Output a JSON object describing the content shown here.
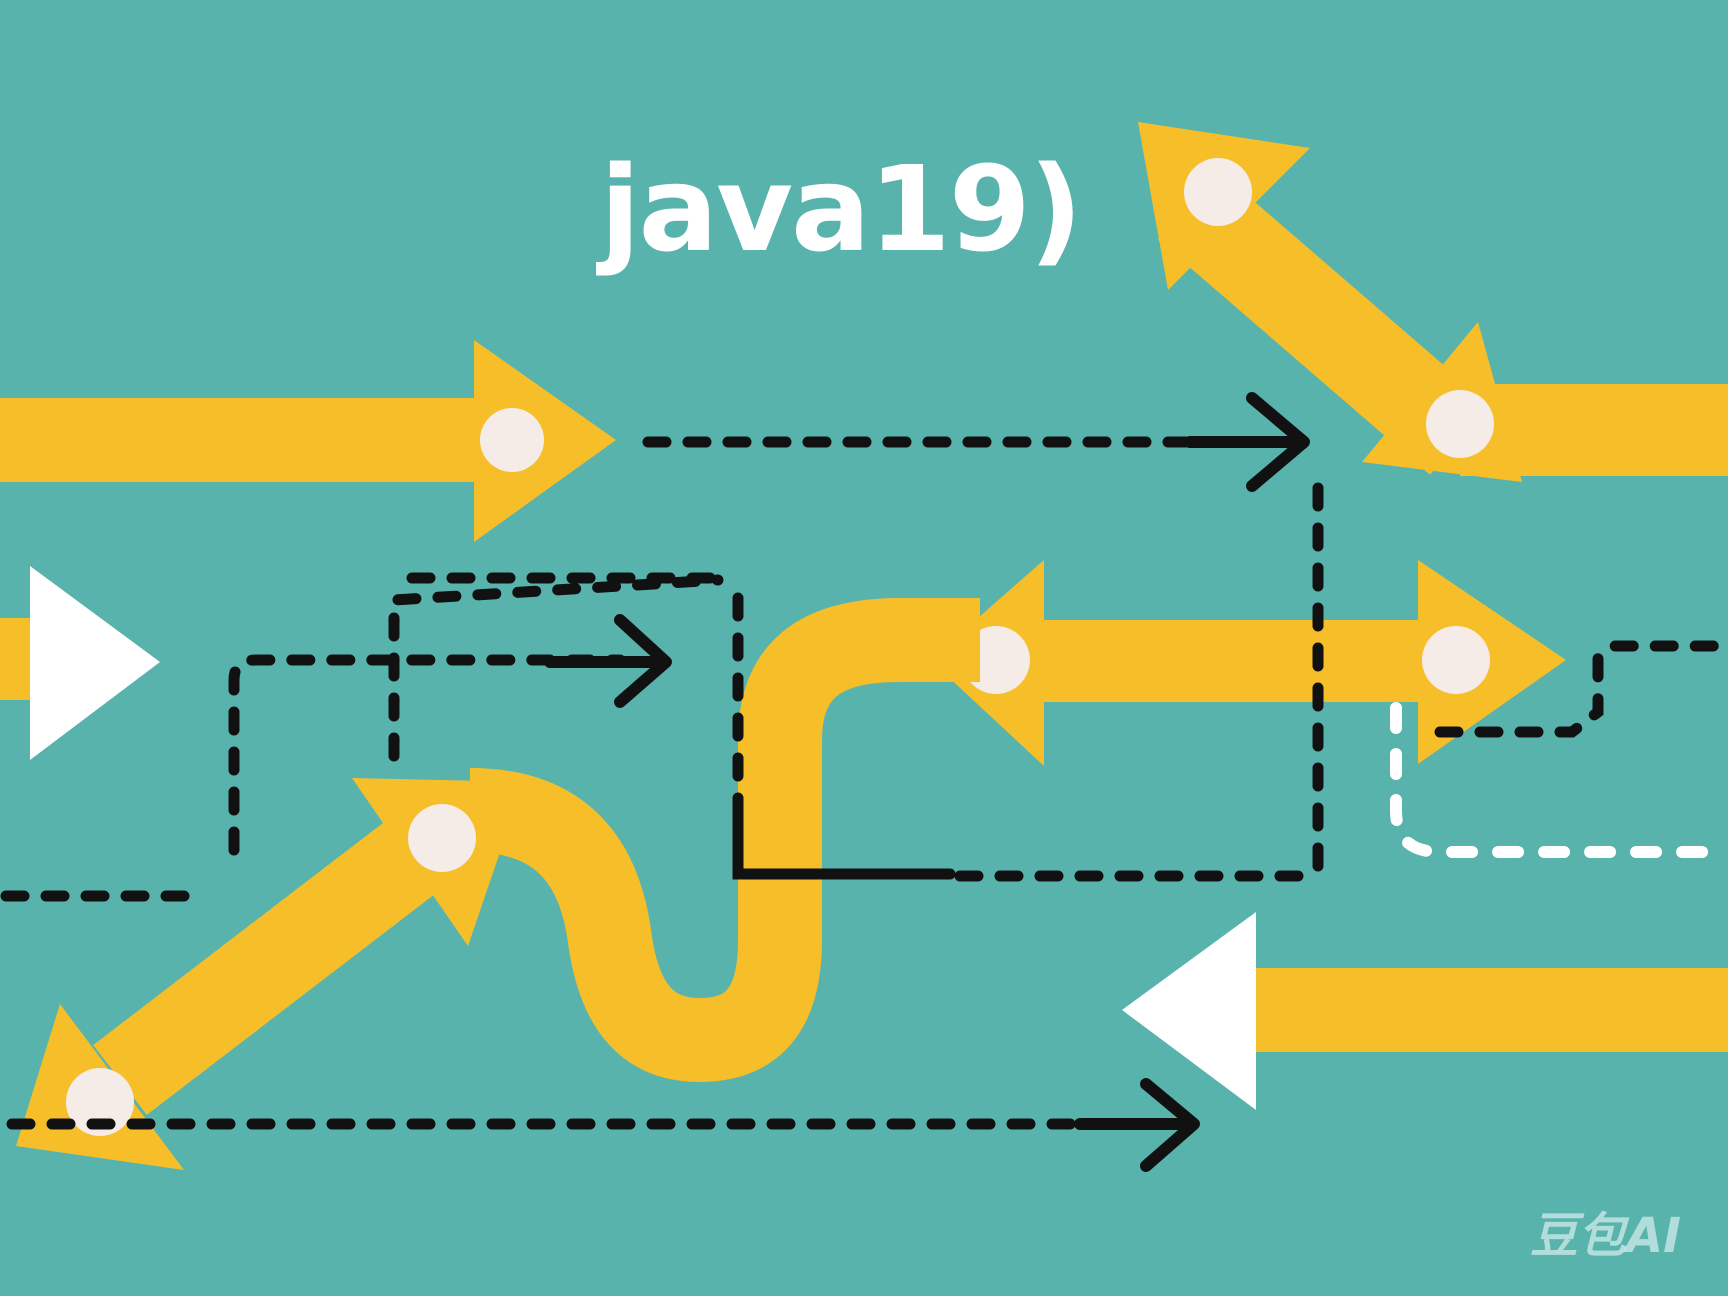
{
  "heading": {
    "text": "java19)"
  },
  "watermark": {
    "text": "豆包AI"
  },
  "colors": {
    "background": "#58b3ad",
    "arrow_yellow": "#f6bf2a",
    "node_fill": "#f5ebe7",
    "dash_black": "#111111",
    "dash_white": "#ffffff",
    "text_white": "#ffffff"
  }
}
